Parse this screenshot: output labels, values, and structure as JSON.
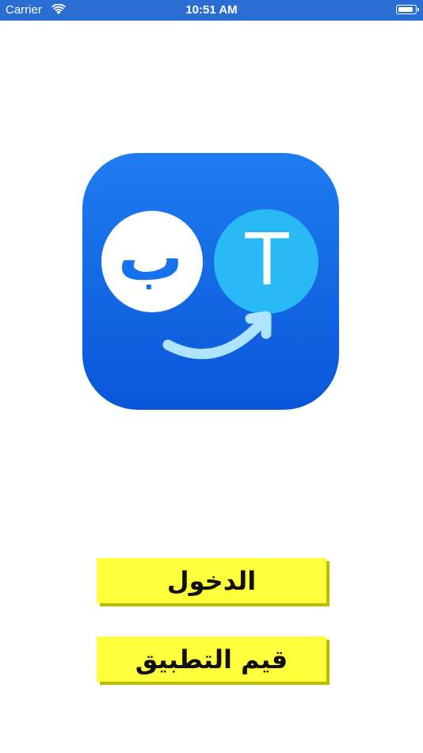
{
  "status_bar": {
    "carrier": "Carrier",
    "time": "10:51 AM",
    "wifi_icon": "wifi-icon",
    "battery_icon": "battery-icon",
    "background": "#2a6ed4"
  },
  "logo": {
    "icon": "translate-app-logo",
    "arabic_glyph": "ب",
    "latin_glyph": "T",
    "colors": {
      "gradient_top": "#1e7cf0",
      "gradient_bottom": "#0a56da",
      "bubble_light": "#29b9f5"
    }
  },
  "buttons": {
    "login_label": "الدخول",
    "rate_label": "قيم التطبيق",
    "color": "#ffff3b",
    "shadow_color": "#bdbd00"
  }
}
